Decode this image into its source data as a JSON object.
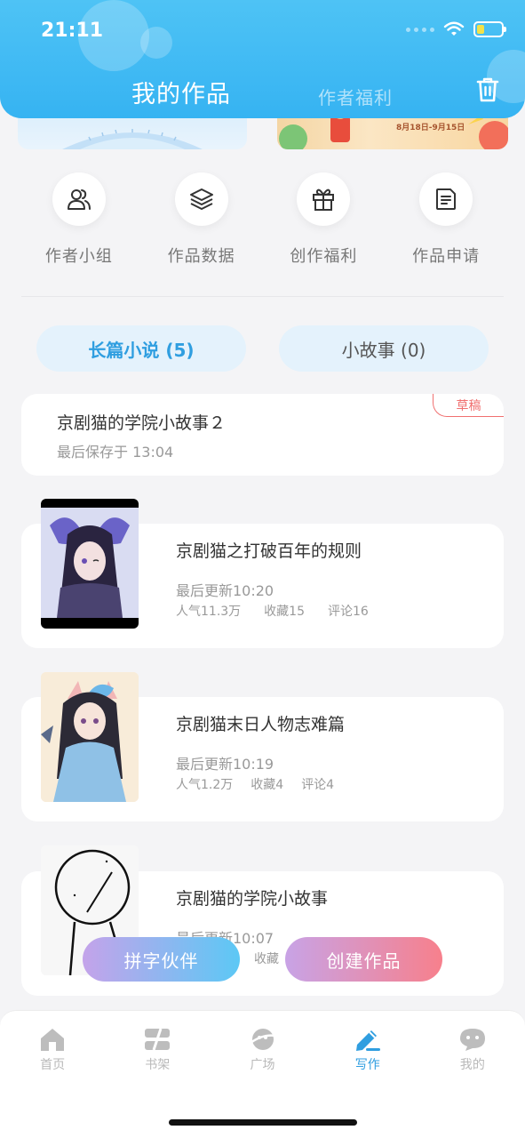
{
  "status": {
    "time": "21:11"
  },
  "header": {
    "tab_active": "我的作品",
    "tab_inactive": "作者福利"
  },
  "banner": {
    "date_range": "8月18日-9月15日"
  },
  "actions": [
    {
      "label": "作者小组",
      "icon": "group-icon"
    },
    {
      "label": "作品数据",
      "icon": "layers-icon"
    },
    {
      "label": "创作福利",
      "icon": "gift-icon"
    },
    {
      "label": "作品申请",
      "icon": "document-icon"
    }
  ],
  "segments": {
    "long": "长篇小说 (5)",
    "short": "小故事 (0)"
  },
  "draft": {
    "title": "京剧猫的学院小故事２",
    "saved": "最后保存于 13:04",
    "badge": "草稿"
  },
  "works": [
    {
      "title": "京剧猫之打破百年的规则",
      "updated": "最后更新10:20",
      "popularity": "人气11.3万",
      "favorites": "收藏15",
      "comments": "评论16"
    },
    {
      "title": "京剧猫末日人物志难篇",
      "updated": "最后更新10:19",
      "popularity": "人气1.2万",
      "favorites": "收藏4",
      "comments": "评论4"
    },
    {
      "title": "京剧猫的学院小故事",
      "updated": "最后更新10:07",
      "favorites": "收藏"
    }
  ],
  "float": {
    "partner": "拼字伙伴",
    "create": "创建作品"
  },
  "tabbar": [
    {
      "label": "首页",
      "icon": "home-icon"
    },
    {
      "label": "书架",
      "icon": "bookshelf-icon"
    },
    {
      "label": "广场",
      "icon": "planet-icon"
    },
    {
      "label": "写作",
      "icon": "pen-icon"
    },
    {
      "label": "我的",
      "icon": "chat-bubble-icon"
    }
  ],
  "colors": {
    "header": "#36b3f2",
    "accent": "#2f9ee0",
    "draft_badge": "#f07070"
  }
}
